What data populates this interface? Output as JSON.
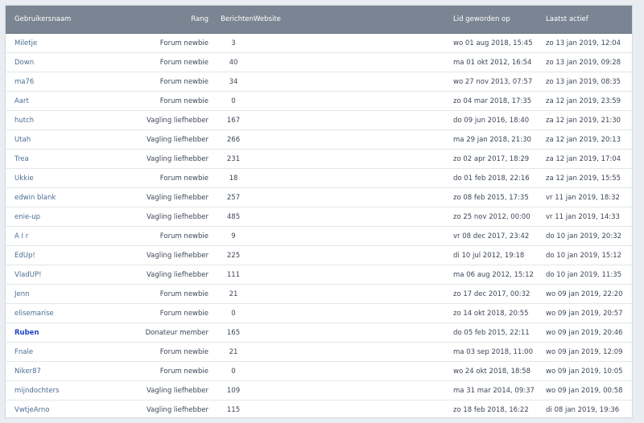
{
  "table": {
    "headers": {
      "username": "Gebruikersnaam",
      "rank": "Rang",
      "posts": "Berichten",
      "website": "Website",
      "joined": "Lid geworden op",
      "last_active": "Laatst actief"
    },
    "rows": [
      {
        "name": "Miletje",
        "rank": "Forum newbie",
        "posts": "3",
        "joined": "wo 01 aug 2018, 15:45",
        "last_active": "zo 13 jan 2019, 12:04"
      },
      {
        "name": "Down",
        "rank": "Forum newbie",
        "posts": "40",
        "joined": "ma 01 okt 2012, 16:54",
        "last_active": "zo 13 jan 2019, 09:28"
      },
      {
        "name": "ma76",
        "rank": "Forum newbie",
        "posts": "34",
        "joined": "wo 27 nov 2013, 07:57",
        "last_active": "zo 13 jan 2019, 08:35"
      },
      {
        "name": "Aart",
        "rank": "Forum newbie",
        "posts": "0",
        "joined": "zo 04 mar 2018, 17:35",
        "last_active": "za 12 jan 2019, 23:59"
      },
      {
        "name": "hutch",
        "rank": "Vagling liefhebber",
        "posts": "167",
        "joined": "do 09 jun 2016, 18:40",
        "last_active": "za 12 jan 2019, 21:30"
      },
      {
        "name": "Utah",
        "rank": "Vagling liefhebber",
        "posts": "266",
        "joined": "ma 29 jan 2018, 21:30",
        "last_active": "za 12 jan 2019, 20:13"
      },
      {
        "name": "Trea",
        "rank": "Vagling liefhebber",
        "posts": "231",
        "joined": "zo 02 apr 2017, 18:29",
        "last_active": "za 12 jan 2019, 17:04"
      },
      {
        "name": "Ukkie",
        "rank": "Forum newbie",
        "posts": "18",
        "joined": "do 01 feb 2018, 22:16",
        "last_active": "za 12 jan 2019, 15:55"
      },
      {
        "name": "edwin blank",
        "rank": "Vagling liefhebber",
        "posts": "257",
        "joined": "zo 08 feb 2015, 17:35",
        "last_active": "vr 11 jan 2019, 18:32"
      },
      {
        "name": "enie-up",
        "rank": "Vagling liefhebber",
        "posts": "485",
        "joined": "zo 25 nov 2012, 00:00",
        "last_active": "vr 11 jan 2019, 14:33"
      },
      {
        "name": "A I r",
        "rank": "Forum newbie",
        "posts": "9",
        "joined": "vr 08 dec 2017, 23:42",
        "last_active": "do 10 jan 2019, 20:32"
      },
      {
        "name": "EdUp!",
        "rank": "Vagling liefhebber",
        "posts": "225",
        "joined": "di 10 jul 2012, 19:18",
        "last_active": "do 10 jan 2019, 15:12"
      },
      {
        "name": "VladUP!",
        "rank": "Vagling liefhebber",
        "posts": "111",
        "joined": "ma 06 aug 2012, 15:12",
        "last_active": "do 10 jan 2019, 11:35"
      },
      {
        "name": "Jenn",
        "rank": "Forum newbie",
        "posts": "21",
        "joined": "zo 17 dec 2017, 00:32",
        "last_active": "wo 09 jan 2019, 22:20"
      },
      {
        "name": "elisemarise",
        "rank": "Forum newbie",
        "posts": "0",
        "joined": "zo 14 okt 2018, 20:55",
        "last_active": "wo 09 jan 2019, 20:57"
      },
      {
        "name": "Ruben",
        "rank": "Donateur member",
        "posts": "165",
        "joined": "do 05 feb 2015, 22:11",
        "last_active": "wo 09 jan 2019, 20:46",
        "special": true
      },
      {
        "name": "Fnale",
        "rank": "Forum newbie",
        "posts": "21",
        "joined": "ma 03 sep 2018, 11:00",
        "last_active": "wo 09 jan 2019, 12:09"
      },
      {
        "name": "Niker87",
        "rank": "Forum newbie",
        "posts": "0",
        "joined": "wo 24 okt 2018, 18:58",
        "last_active": "wo 09 jan 2019, 10:05"
      },
      {
        "name": "mijndochters",
        "rank": "Vagling liefhebber",
        "posts": "109",
        "joined": "ma 31 mar 2014, 09:37",
        "last_active": "wo 09 jan 2019, 00:58"
      },
      {
        "name": "VwtjeArno",
        "rank": "Vagling liefhebber",
        "posts": "115",
        "joined": "zo 18 feb 2018, 16:22",
        "last_active": "di 08 jan 2019, 19:36"
      }
    ]
  },
  "colors": {
    "header_bg": "#7a8593",
    "link": "#4b6d94",
    "special_user": "#1f44c7",
    "row_border": "#e3e6ea",
    "page_bg": "#e9ecf0"
  }
}
